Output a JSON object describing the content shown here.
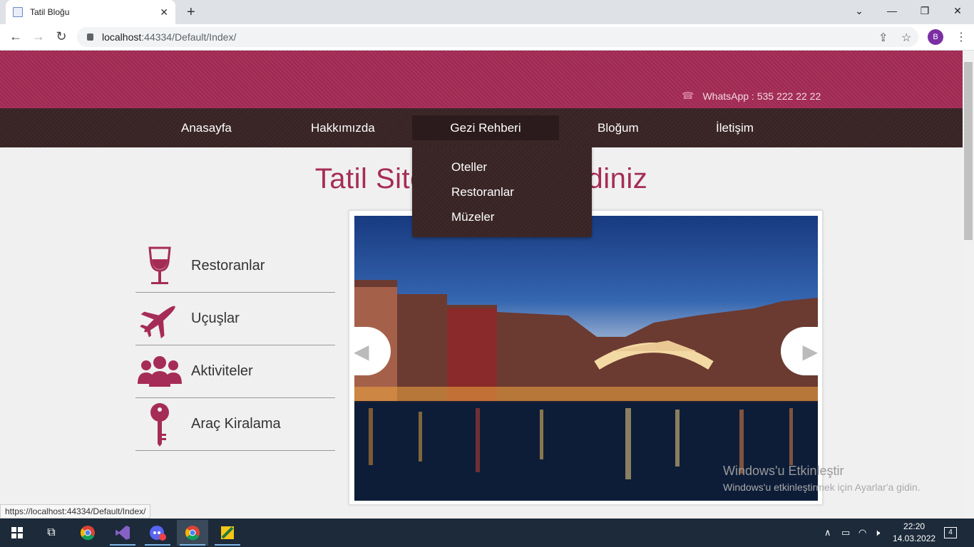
{
  "browser": {
    "tab_title": "Tatil Bloğu",
    "tab_close": "✕",
    "new_tab": "+",
    "url_host": "localhost",
    "url_path": ":44334/Default/Index/",
    "profile_initial": "B",
    "status_url": "https://localhost:44334/Default/Index/"
  },
  "header": {
    "whatsapp": "WhatsApp : 535 222 22 22"
  },
  "nav": {
    "items": [
      "Anasayfa",
      "Hakkımızda",
      "Gezi Rehberi",
      "Bloğum",
      "İletişim"
    ],
    "dropdown": [
      "Oteller",
      "Restoranlar",
      "Müzeler"
    ]
  },
  "page": {
    "title": "Tatil Sitemize Hoşgeldiniz"
  },
  "sidebar": {
    "items": [
      "Restoranlar",
      "Uçuşlar",
      "Aktiviteler",
      "Araç Kiralama"
    ]
  },
  "watermark": {
    "line1": "Windows'u Etkinleştir",
    "line2": "Windows'u etkinleştirmek için Ayarlar'a gidin."
  },
  "taskbar": {
    "time": "22:20",
    "date": "14.03.2022",
    "notifications": "4"
  },
  "colors": {
    "accent": "#a52c56",
    "nav_bg": "#3a2526"
  }
}
